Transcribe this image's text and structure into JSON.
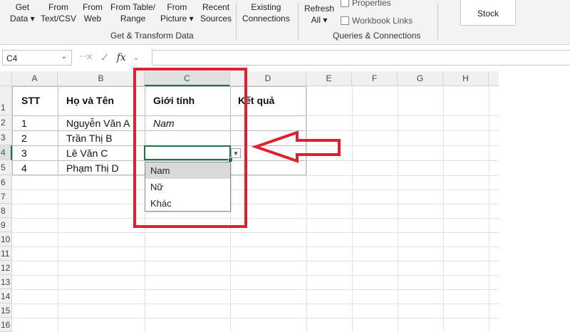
{
  "ribbon": {
    "get_transform": {
      "buttons": [
        {
          "line1": "Get",
          "line2": "Data ▾"
        },
        {
          "line1": "From",
          "line2": "Text/CSV"
        },
        {
          "line1": "From",
          "line2": "Web"
        },
        {
          "line1": "From Table/",
          "line2": "Range"
        },
        {
          "line1": "From",
          "line2": "Picture ▾"
        },
        {
          "line1": "Recent",
          "line2": "Sources"
        },
        {
          "line1": "Existing",
          "line2": "Connections"
        }
      ],
      "label": "Get & Transform Data"
    },
    "queries": {
      "refresh": {
        "line1": "Refresh",
        "line2": "All ▾"
      },
      "properties": "Properties",
      "workbook_links": "Workbook Links",
      "label": "Queries & Connections"
    },
    "stock": "Stock"
  },
  "formula_bar": {
    "name_box": "C4",
    "cancel_icon": "×",
    "enter_icon": "✓",
    "fx_label": "fx",
    "formula": ""
  },
  "grid": {
    "columns": [
      "A",
      "B",
      "C",
      "D",
      "E",
      "F",
      "G",
      "H"
    ],
    "rows": [
      "1",
      "2",
      "3",
      "4",
      "5",
      "6",
      "7",
      "8",
      "9",
      "10",
      "11",
      "12",
      "13",
      "14",
      "15",
      "16"
    ],
    "headers": {
      "stt": "STT",
      "name": "Họ và Tên",
      "gender": "Giới tính",
      "result": "Kết quả"
    },
    "data": [
      {
        "stt": "1",
        "name": "Nguyễn Văn A",
        "gender": "Nam"
      },
      {
        "stt": "2",
        "name": "Trần Thị B",
        "gender": ""
      },
      {
        "stt": "3",
        "name": "Lê Văn C",
        "gender": ""
      },
      {
        "stt": "4",
        "name": "Phạm Thị D",
        "gender": ""
      }
    ],
    "active_cell": "C4"
  },
  "dropdown": {
    "options": [
      "Nam",
      "Nữ",
      "Khác"
    ],
    "highlighted": "Nam"
  },
  "colors": {
    "accent": "#1e7145",
    "annotation": "#e0202e"
  }
}
